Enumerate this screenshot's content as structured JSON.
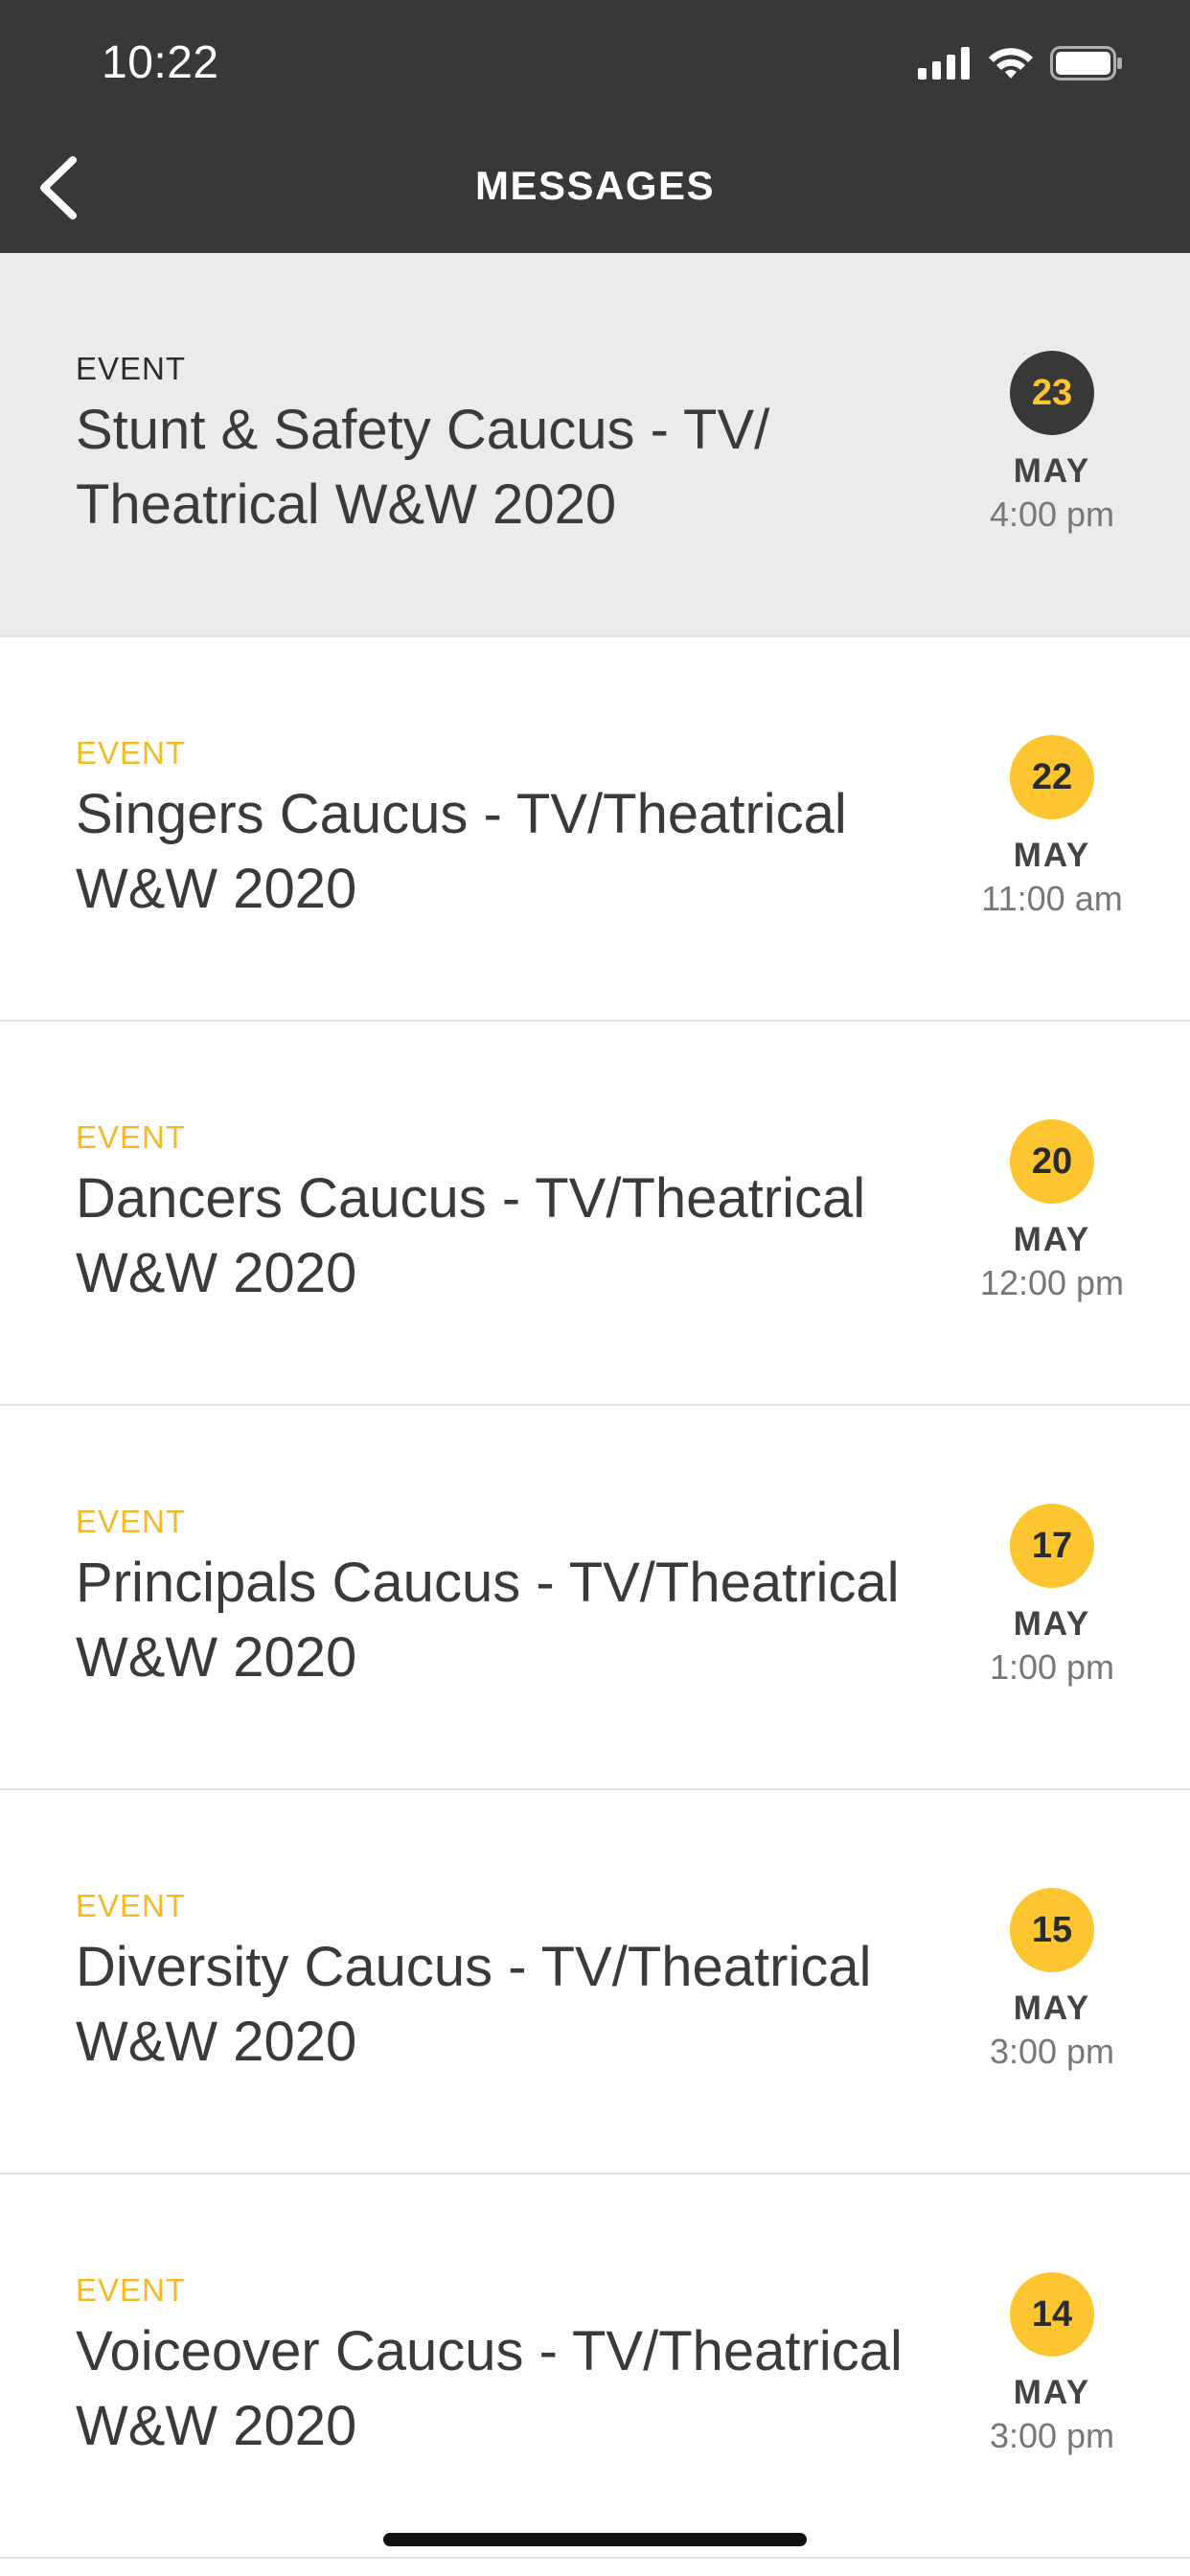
{
  "status_bar": {
    "time": "10:22",
    "icons": [
      "cellular-signal-icon",
      "wifi-icon",
      "battery-icon"
    ]
  },
  "header": {
    "title": "MESSAGES",
    "back_icon": "chevron-left-icon"
  },
  "colors": {
    "header_bg": "#383836",
    "accent": "#fdc530",
    "selected_row_bg": "#ebebeb"
  },
  "messages": [
    {
      "type": "EVENT",
      "title": "Stunt & Safety Caucus - TV/ Theatrical W&W 2020",
      "day": "23",
      "month": "MAY",
      "time": "4:00 pm",
      "selected": true
    },
    {
      "type": "EVENT",
      "title": "Singers Caucus - TV/Theatrical W&W 2020",
      "day": "22",
      "month": "MAY",
      "time": "11:00 am",
      "selected": false
    },
    {
      "type": "EVENT",
      "title": "Dancers Caucus - TV/Theatrical W&W 2020",
      "day": "20",
      "month": "MAY",
      "time": "12:00 pm",
      "selected": false
    },
    {
      "type": "EVENT",
      "title": "Principals Caucus - TV/Theatrical W&W 2020",
      "day": "17",
      "month": "MAY",
      "time": "1:00 pm",
      "selected": false
    },
    {
      "type": "EVENT",
      "title": "Diversity Caucus - TV/Theatrical W&W 2020",
      "day": "15",
      "month": "MAY",
      "time": "3:00 pm",
      "selected": false
    },
    {
      "type": "EVENT",
      "title": "Voiceover Caucus - TV/Theatrical W&W 2020",
      "day": "14",
      "month": "MAY",
      "time": "3:00 pm",
      "selected": false
    }
  ]
}
